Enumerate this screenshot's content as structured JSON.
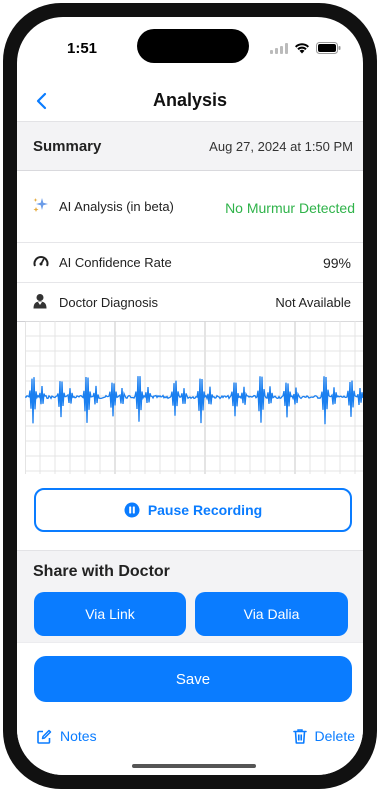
{
  "status_bar": {
    "time": "1:51"
  },
  "nav": {
    "title": "Analysis"
  },
  "summary": {
    "label": "Summary",
    "date": "Aug 27, 2024 at 1:50 PM"
  },
  "rows": {
    "ai_analysis": {
      "label": "AI Analysis (in beta)",
      "value": "No Murmur Detected",
      "value_color": "#2fb34a"
    },
    "confidence": {
      "label": "AI Confidence Rate",
      "value": "99%"
    },
    "diagnosis": {
      "label": "Doctor Diagnosis",
      "value": "Not Available"
    }
  },
  "recording": {
    "pause_label": "Pause Recording"
  },
  "share": {
    "title": "Share with Doctor",
    "via_link_label": "Via Link",
    "via_dalia_label": "Via Dalia"
  },
  "actions": {
    "save_label": "Save",
    "notes_label": "Notes",
    "delete_label": "Delete"
  },
  "colors": {
    "accent": "#0a7cff",
    "success": "#2fb34a",
    "waveform": "#1a7ff0",
    "grid": "#e2e2e2"
  }
}
